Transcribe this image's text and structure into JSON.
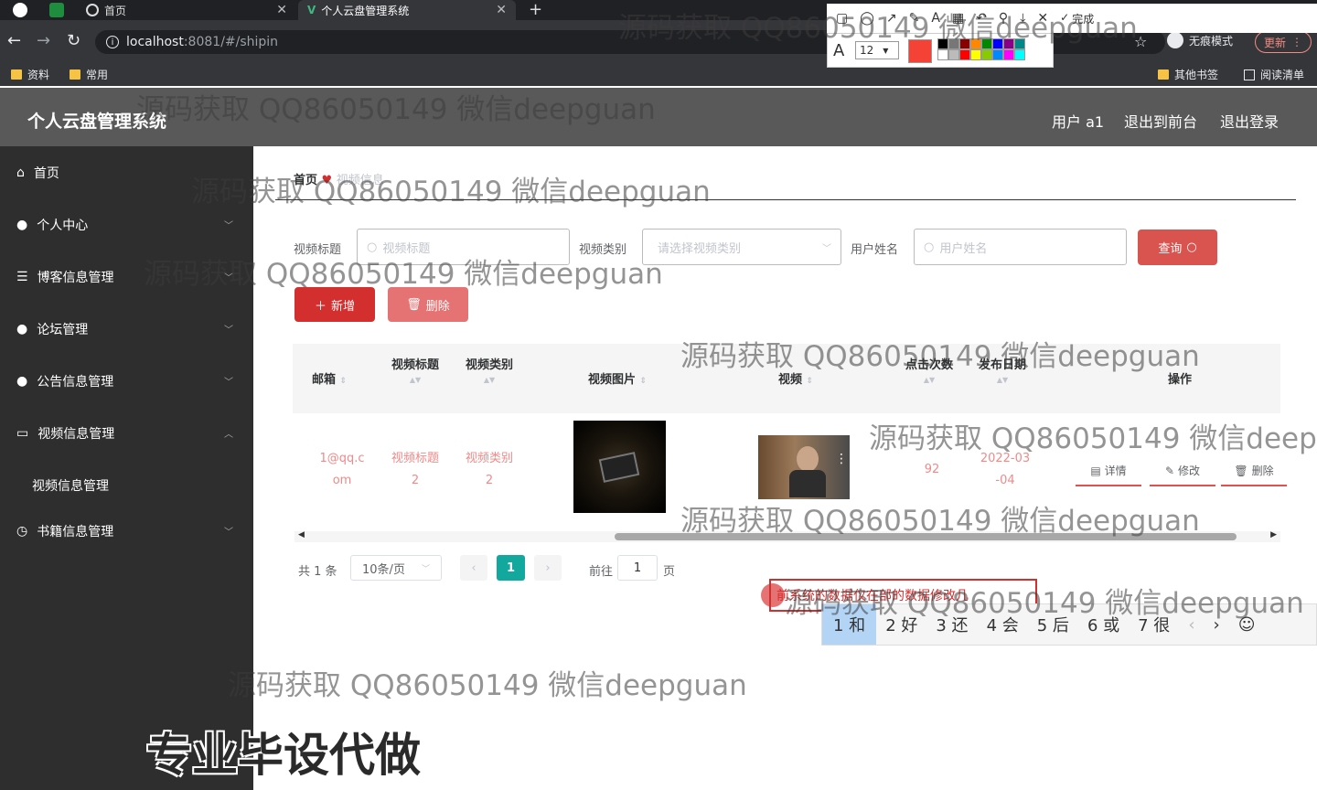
{
  "browser": {
    "tabs": [
      {
        "label": "首页"
      },
      {
        "label": "个人云盘管理系统"
      }
    ],
    "url_host": "localhost",
    "url_rest": ":8081/#/shipin",
    "bookmarks": [
      "资料",
      "常用"
    ],
    "bookmarks_right": [
      "其他书签",
      "阅读清单"
    ],
    "incognito": "无痕模式",
    "update": "更新",
    "finish": "完成",
    "font_size": "12"
  },
  "header": {
    "title": "个人云盘管理系统",
    "user": "用户 a1",
    "front": "退出到前台",
    "logout": "退出登录"
  },
  "sidebar": {
    "items": [
      {
        "label": "首页"
      },
      {
        "label": "个人中心"
      },
      {
        "label": "博客信息管理"
      },
      {
        "label": "论坛管理"
      },
      {
        "label": "公告信息管理"
      },
      {
        "label": "视频信息管理"
      },
      {
        "label": "视频信息管理"
      },
      {
        "label": "书籍信息管理"
      }
    ]
  },
  "breadcrumb": {
    "home": "首页",
    "current": "视频信息"
  },
  "search": {
    "title_label": "视频标题",
    "title_ph": "视频标题",
    "type_label": "视频类别",
    "type_ph": "请选择视频类别",
    "user_label": "用户姓名",
    "user_ph": "用户姓名",
    "query": "查询"
  },
  "actions": {
    "add": "新增",
    "delete": "删除"
  },
  "table": {
    "headers": [
      "邮箱",
      "视频标题",
      "视频类别",
      "视频图片",
      "视频",
      "点击次数",
      "发布日期",
      "操作"
    ],
    "row": {
      "email_1": "1@qq.c",
      "email_2": "om",
      "title_1": "视频标题",
      "title_2": "2",
      "type_1": "视频类别",
      "type_2": "2",
      "clicks": "92",
      "date_1": "2022-03",
      "date_2": "-04",
      "op_detail": "详情",
      "op_edit": "修改",
      "op_delete": "删除"
    }
  },
  "pager": {
    "total": "共 1 条",
    "size": "10条/页",
    "page": "1",
    "goto": "前往",
    "goto_val": "1",
    "unit": "页"
  },
  "ime": [
    "1 和",
    "2 好",
    "3 还",
    "4 会",
    "5 后",
    "6 或",
    "7 很"
  ],
  "overlay_text": "前系统的数据仅在部的数据修改几",
  "watermark": "源码获取 QQ86050149 微信deepguan",
  "promo": "专业毕设代做"
}
